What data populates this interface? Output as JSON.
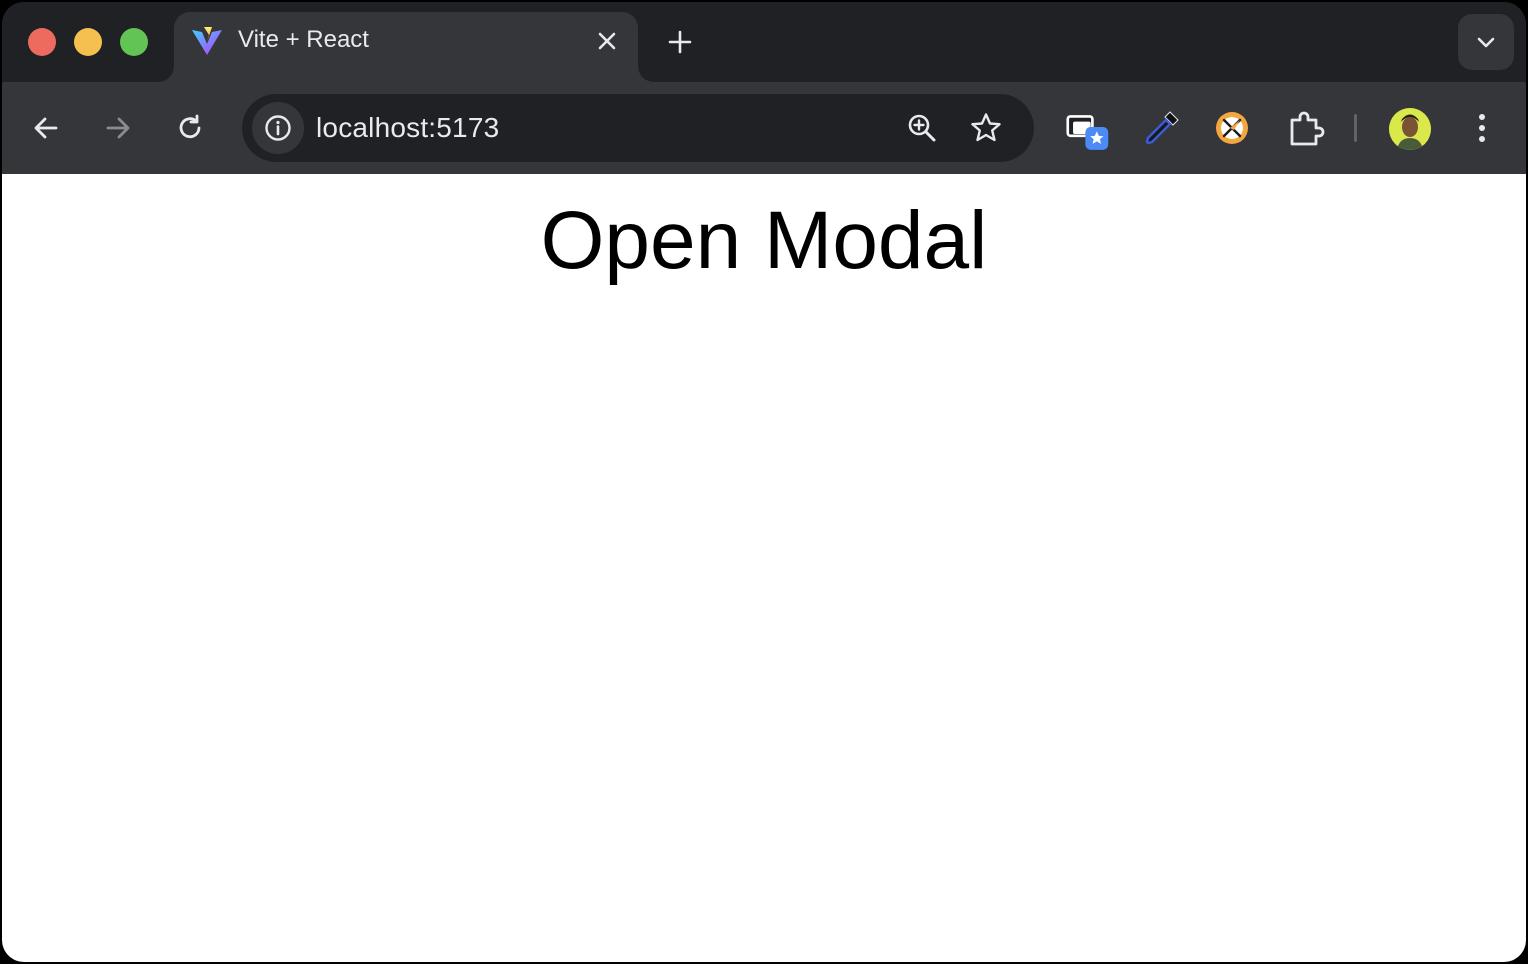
{
  "browser": {
    "tab": {
      "title": "Vite + React",
      "favicon": "vite-logo-icon"
    },
    "address_bar": {
      "url": "localhost:5173"
    },
    "icons": {
      "back": "arrow-left-icon",
      "forward": "arrow-right-icon",
      "reload": "reload-icon",
      "site_info": "info-icon",
      "zoom": "zoom-in-icon",
      "bookmark": "star-icon",
      "reading_list": "reading-list-icon",
      "eyedropper": "eyedropper-icon",
      "extension_orange": "compass-extension-icon",
      "extensions": "puzzle-icon",
      "profile": "avatar",
      "menu": "more-vert-icon",
      "new_tab": "plus-icon",
      "tab_search": "chevron-down-icon"
    },
    "colors": {
      "frame": "#202124",
      "toolbar": "#35363a",
      "text": "#e8eaed",
      "close": "#ed6a5e",
      "minimize": "#f5c04f",
      "maximize": "#61c454"
    }
  },
  "page": {
    "button_label": "Open Modal"
  }
}
